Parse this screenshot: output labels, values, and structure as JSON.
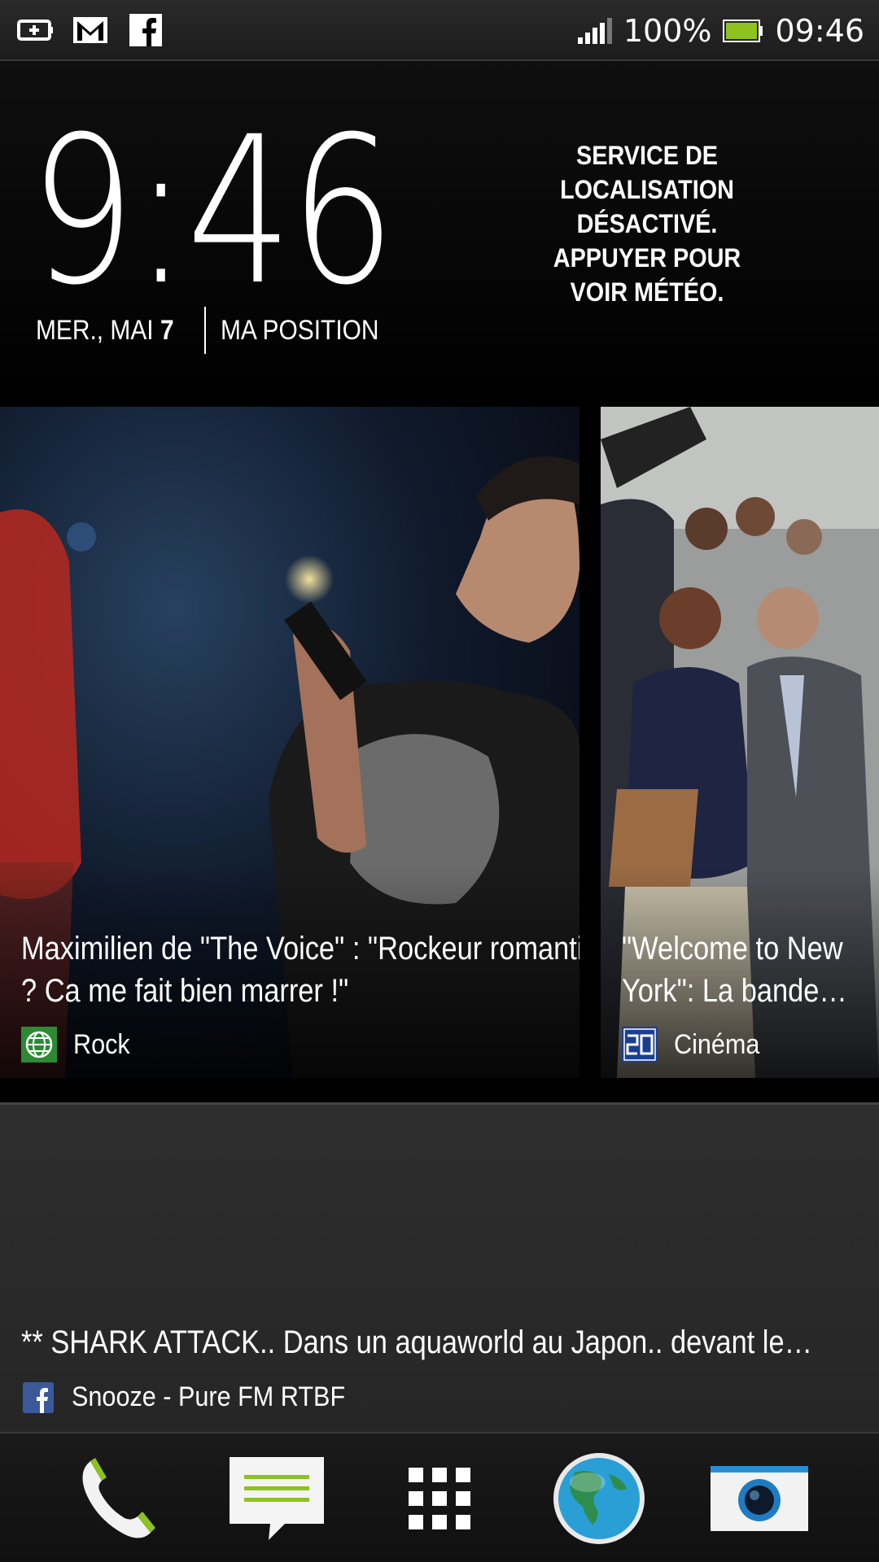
{
  "status_bar": {
    "notification_icons": [
      "battery-saver-icon",
      "gmail-icon",
      "facebook-icon"
    ],
    "battery_percent": "100%",
    "time": "09:46",
    "signal_icon": "signal-bars-icon",
    "battery_icon": "battery-full-icon"
  },
  "clock_widget": {
    "time": "9:46",
    "date_prefix": "MER., MAI ",
    "date_day": "7",
    "location": "MA POSITION",
    "weather_message": "SERVICE DE LOCALISATION DÉSACTIVÉ. APPUYER POUR VOIR MÉTÉO."
  },
  "news_cards": [
    {
      "title": "Maximilien de \"The Voice\" : \"Rockeur romantique ? Ca me fait bien marrer !\"",
      "source_icon": "globe-icon",
      "source": "Rock"
    },
    {
      "title": "\"Welcome to New York\": La bande…",
      "source_icon": "20-minutes-logo-icon",
      "source": "Cinéma"
    }
  ],
  "feed_item": {
    "text": "** SHARK ATTACK.. Dans un aquaworld au Japon.. devant le…",
    "source_icon": "facebook-icon",
    "source": "Snooze - Pure FM RTBF"
  },
  "dock": [
    {
      "name": "phone-icon"
    },
    {
      "name": "messages-icon"
    },
    {
      "name": "app-drawer-icon"
    },
    {
      "name": "browser-globe-icon"
    },
    {
      "name": "camera-icon"
    }
  ],
  "colors": {
    "accent_green": "#8dc21f",
    "facebook_blue": "#3b5998",
    "globe_blue": "#2a9fd6"
  }
}
